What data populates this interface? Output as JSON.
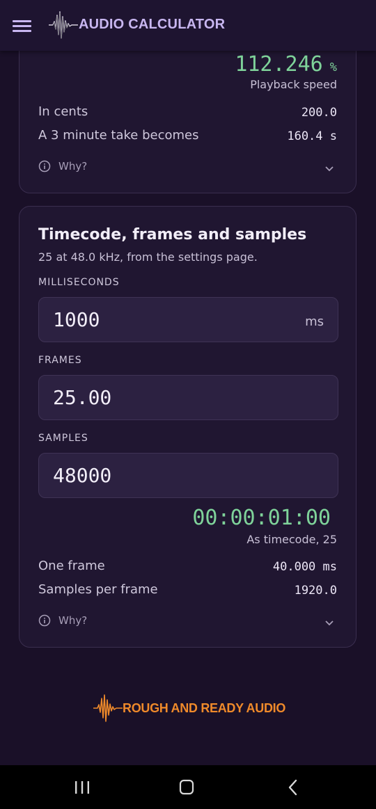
{
  "header": {
    "menu_icon": "hamburger-menu-icon",
    "logo_icon": "audio-waveform-icon",
    "title": "AUDIO CALCULATOR"
  },
  "speed_card": {
    "value": "112.246",
    "unit": "%",
    "caption": "Playback speed",
    "rows": [
      {
        "label": "In cents",
        "value": "200.0"
      },
      {
        "label": "A 3 minute take becomes",
        "value": "160.4 s"
      }
    ],
    "why_label": "Why?"
  },
  "timecode_card": {
    "title": "Timecode, frames and samples",
    "subtitle": "25 at 48.0 kHz, from the settings page.",
    "fields": [
      {
        "label": "MILLISECONDS",
        "value": "1000",
        "suffix": "ms"
      },
      {
        "label": "FRAMES",
        "value": "25.00"
      },
      {
        "label": "SAMPLES",
        "value": "48000"
      }
    ],
    "timecode": "00:00:01:00",
    "timecode_caption": "As timecode, 25",
    "rows": [
      {
        "label": "One frame",
        "value": "40.000 ms"
      },
      {
        "label": "Samples per frame",
        "value": "1920.0"
      }
    ],
    "why_label": "Why?"
  },
  "footer": {
    "brand": "ROUGH AND READY AUDIO",
    "logo_icon": "audio-waveform-icon"
  },
  "navbar": {
    "recent_icon": "recent-apps-icon",
    "home_icon": "home-icon",
    "back_icon": "back-icon"
  },
  "colors": {
    "background": "#1a1028",
    "card": "#201631",
    "accent_green": "#7fd39a",
    "title_purple": "#c8b6f0",
    "brand_orange": "#f08a2a"
  }
}
